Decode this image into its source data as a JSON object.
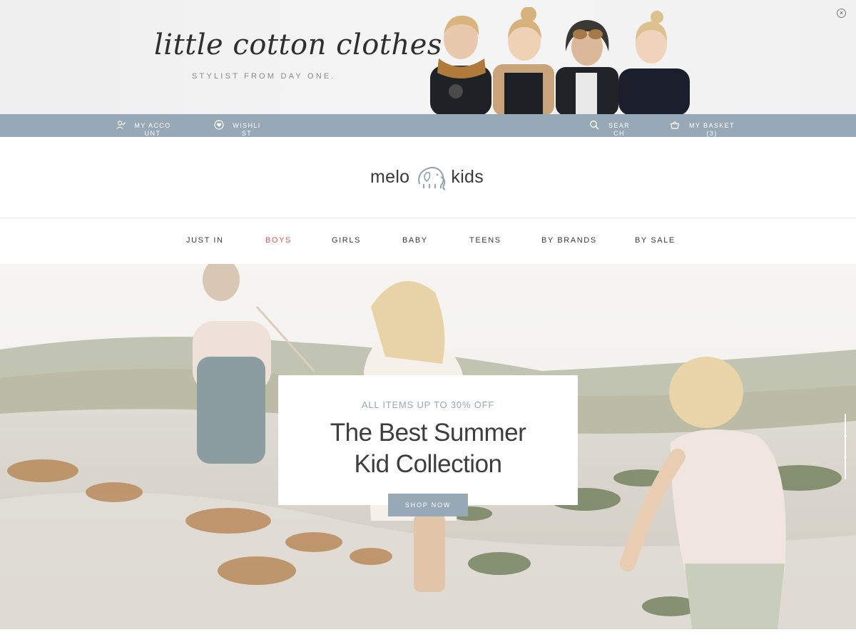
{
  "promo": {
    "script_title": "little cotton clothes",
    "tagline": "STYLIST FROM DAY ONE.",
    "close_icon": "close-icon"
  },
  "utility_bar": {
    "background": "#97a9b6",
    "account": {
      "label": "MY ACCOUNT",
      "icon": "user-icon"
    },
    "wishlist": {
      "label": "WISHLIST",
      "icon": "heart-icon"
    },
    "search": {
      "label": "SEARCH",
      "icon": "search-icon"
    },
    "basket": {
      "label": "MY BASKET(3)",
      "icon": "basket-icon"
    }
  },
  "logo": {
    "left": "melo",
    "right": "kids",
    "icon": "elephant-icon"
  },
  "nav": {
    "items": [
      {
        "label": "JUST IN"
      },
      {
        "label": "BOYS",
        "active": true,
        "color": "#e05252"
      },
      {
        "label": "GIRLS"
      },
      {
        "label": "BABY"
      },
      {
        "label": "TEENS"
      },
      {
        "label": "BY BRANDS"
      },
      {
        "label": "BY SALE"
      }
    ]
  },
  "hero": {
    "eyebrow": "ALL ITEMS UP TO 30% OFF",
    "title_line1": "The Best Summer",
    "title_line2": "Kid Collection",
    "button": "SHOP NOW"
  }
}
